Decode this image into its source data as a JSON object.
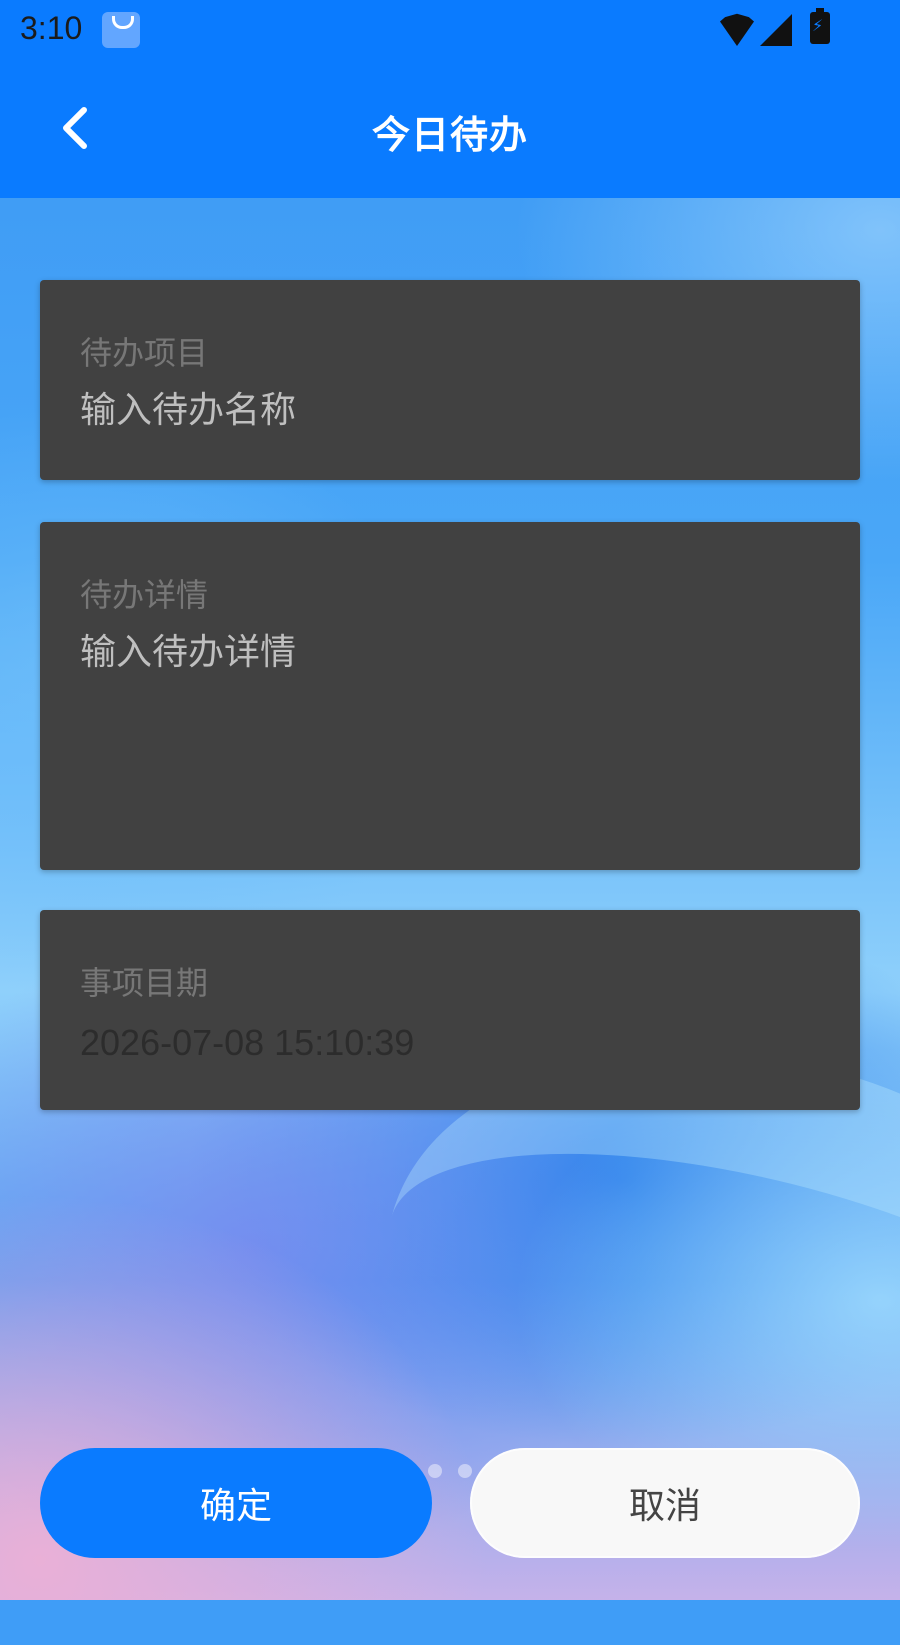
{
  "status_bar": {
    "time": "3:10"
  },
  "header": {
    "title": "今日待办"
  },
  "form": {
    "item": {
      "label": "待办项目",
      "placeholder": "输入待办名称"
    },
    "details": {
      "label": "待办详情",
      "placeholder": "输入待办详情"
    },
    "date": {
      "label": "事项目期",
      "value": "2026-07-08 15:10:39"
    }
  },
  "buttons": {
    "confirm": "确定",
    "cancel": "取消"
  },
  "colors": {
    "primary": "#0a7bff",
    "card": "#414141"
  }
}
